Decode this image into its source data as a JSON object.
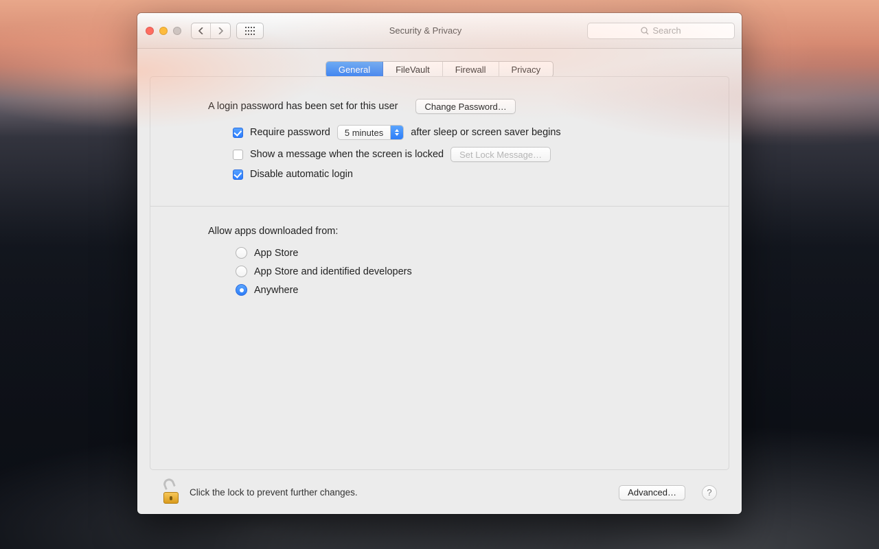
{
  "window": {
    "title": "Security & Privacy"
  },
  "search": {
    "placeholder": "Search"
  },
  "tabs": [
    "General",
    "FileVault",
    "Firewall",
    "Privacy"
  ],
  "active_tab_index": 0,
  "general": {
    "login_message": "A login password has been set for this user",
    "change_password_btn": "Change Password…",
    "require_password": {
      "checked": true,
      "label_before": "Require password",
      "value": "5 minutes",
      "label_after": "after sleep or screen saver begins"
    },
    "show_lock_message": {
      "checked": false,
      "label": "Show a message when the screen is locked",
      "button": "Set Lock Message…",
      "button_enabled": false
    },
    "disable_auto_login": {
      "checked": true,
      "label": "Disable automatic login"
    },
    "allow_apps": {
      "heading": "Allow apps downloaded from:",
      "options": [
        "App Store",
        "App Store and identified developers",
        "Anywhere"
      ],
      "selected_index": 2
    }
  },
  "footer": {
    "lock_message": "Click the lock to prevent further changes.",
    "advanced_btn": "Advanced…"
  }
}
